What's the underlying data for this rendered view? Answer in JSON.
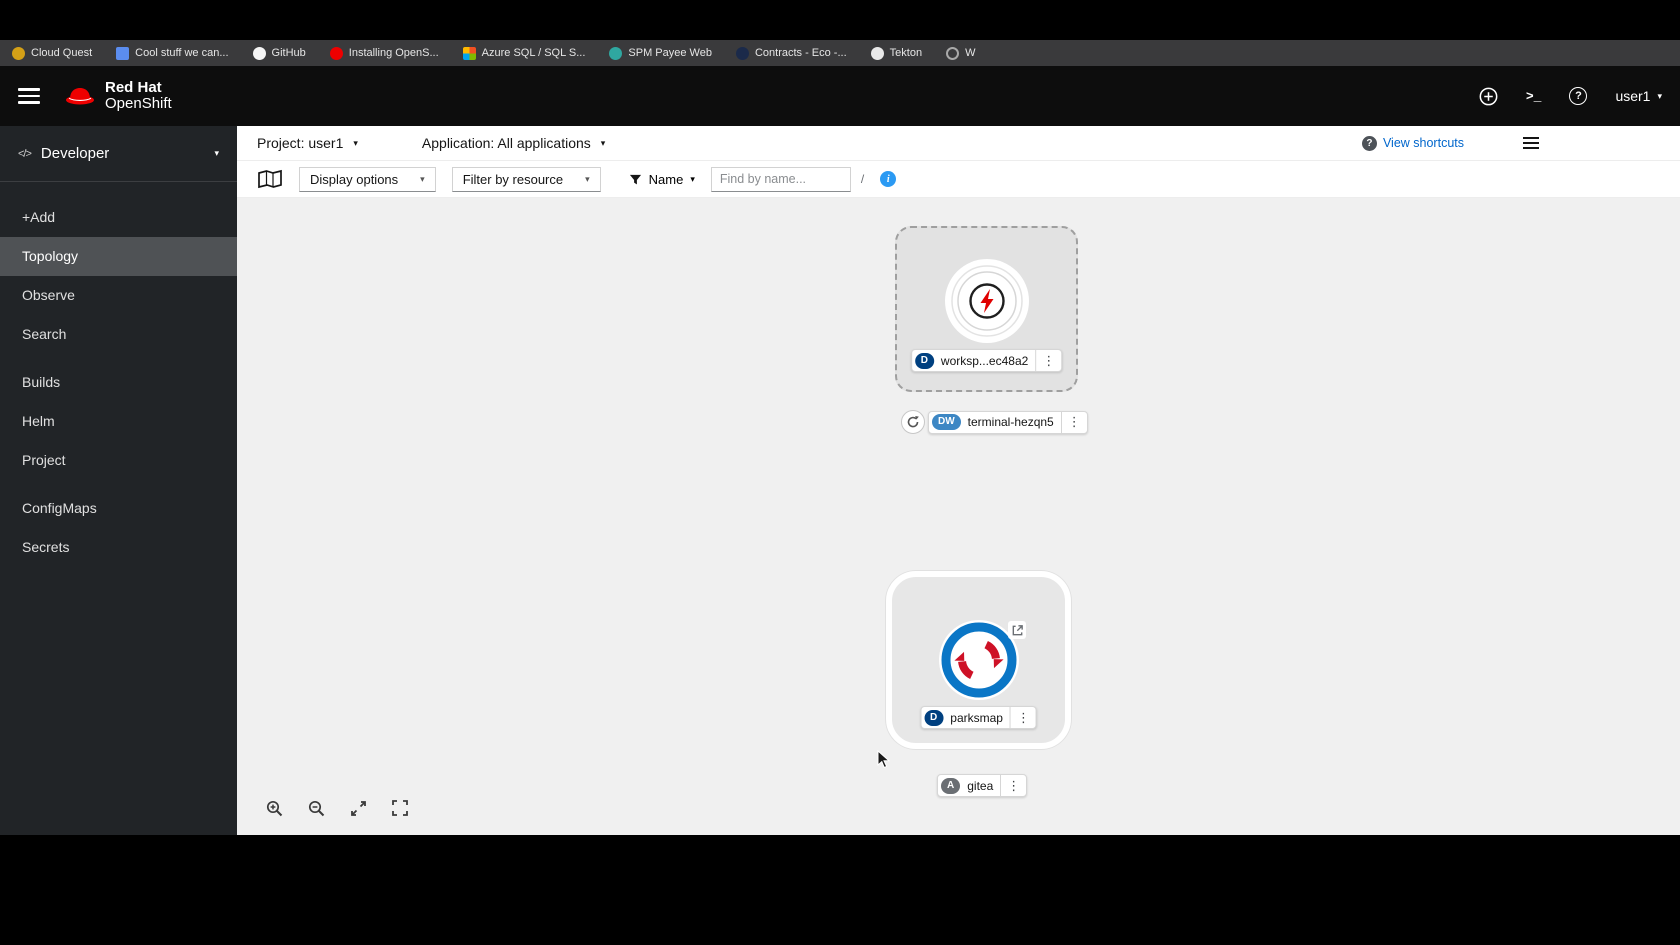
{
  "bookmarks": {
    "items": [
      {
        "label": "Cloud Quest"
      },
      {
        "label": "Cool stuff we can..."
      },
      {
        "label": "GitHub"
      },
      {
        "label": "Installing OpenS..."
      },
      {
        "label": "Azure SQL / SQL S..."
      },
      {
        "label": "SPM Payee Web"
      },
      {
        "label": "Contracts - Eco -..."
      },
      {
        "label": "Tekton"
      },
      {
        "label": "W"
      }
    ]
  },
  "masthead": {
    "brand_line1": "Red Hat",
    "brand_line2": "OpenShift",
    "username": "user1"
  },
  "sidebar": {
    "perspective": "Developer",
    "items": [
      {
        "label": "+Add",
        "active": false
      },
      {
        "label": "Topology",
        "active": true
      },
      {
        "label": "Observe",
        "active": false
      },
      {
        "label": "Search",
        "active": false
      },
      {
        "label": "Builds",
        "active": false
      },
      {
        "label": "Helm",
        "active": false
      },
      {
        "label": "Project",
        "active": false
      },
      {
        "label": "ConfigMaps",
        "active": false
      },
      {
        "label": "Secrets",
        "active": false
      }
    ]
  },
  "contextbar": {
    "project": "Project: user1",
    "application": "Application: All applications",
    "view_shortcuts": "View shortcuts"
  },
  "toolbar": {
    "display_options": "Display options",
    "filter_by_resource": "Filter by resource",
    "name": "Name",
    "find_placeholder": "Find by name...",
    "find_value": ""
  },
  "topology": {
    "workspace": {
      "badge": "D",
      "label": "worksp...ec48a2"
    },
    "terminal": {
      "badge": "DW",
      "label": "terminal-hezqn5"
    },
    "parksmap": {
      "badge": "D",
      "label": "parksmap"
    },
    "gitea": {
      "badge": "A",
      "label": "gitea"
    }
  },
  "icons": {
    "kebab": "⋮",
    "caret_down": "▾",
    "help": "?",
    "info": "i",
    "terminal_glyph": ">_",
    "developer_code": "</>",
    "slash": "/"
  },
  "colors": {
    "brand_red": "#ee0000",
    "link_blue": "#0066cc",
    "info_blue": "#2b9af3",
    "badge_deployment": "#004080",
    "badge_devworkspace": "#3d87c4",
    "badge_application": "#6a6e73",
    "sidebar_bg": "#212427",
    "sidebar_selected": "#4f5255",
    "canvas_bg": "#f0f0f0"
  }
}
